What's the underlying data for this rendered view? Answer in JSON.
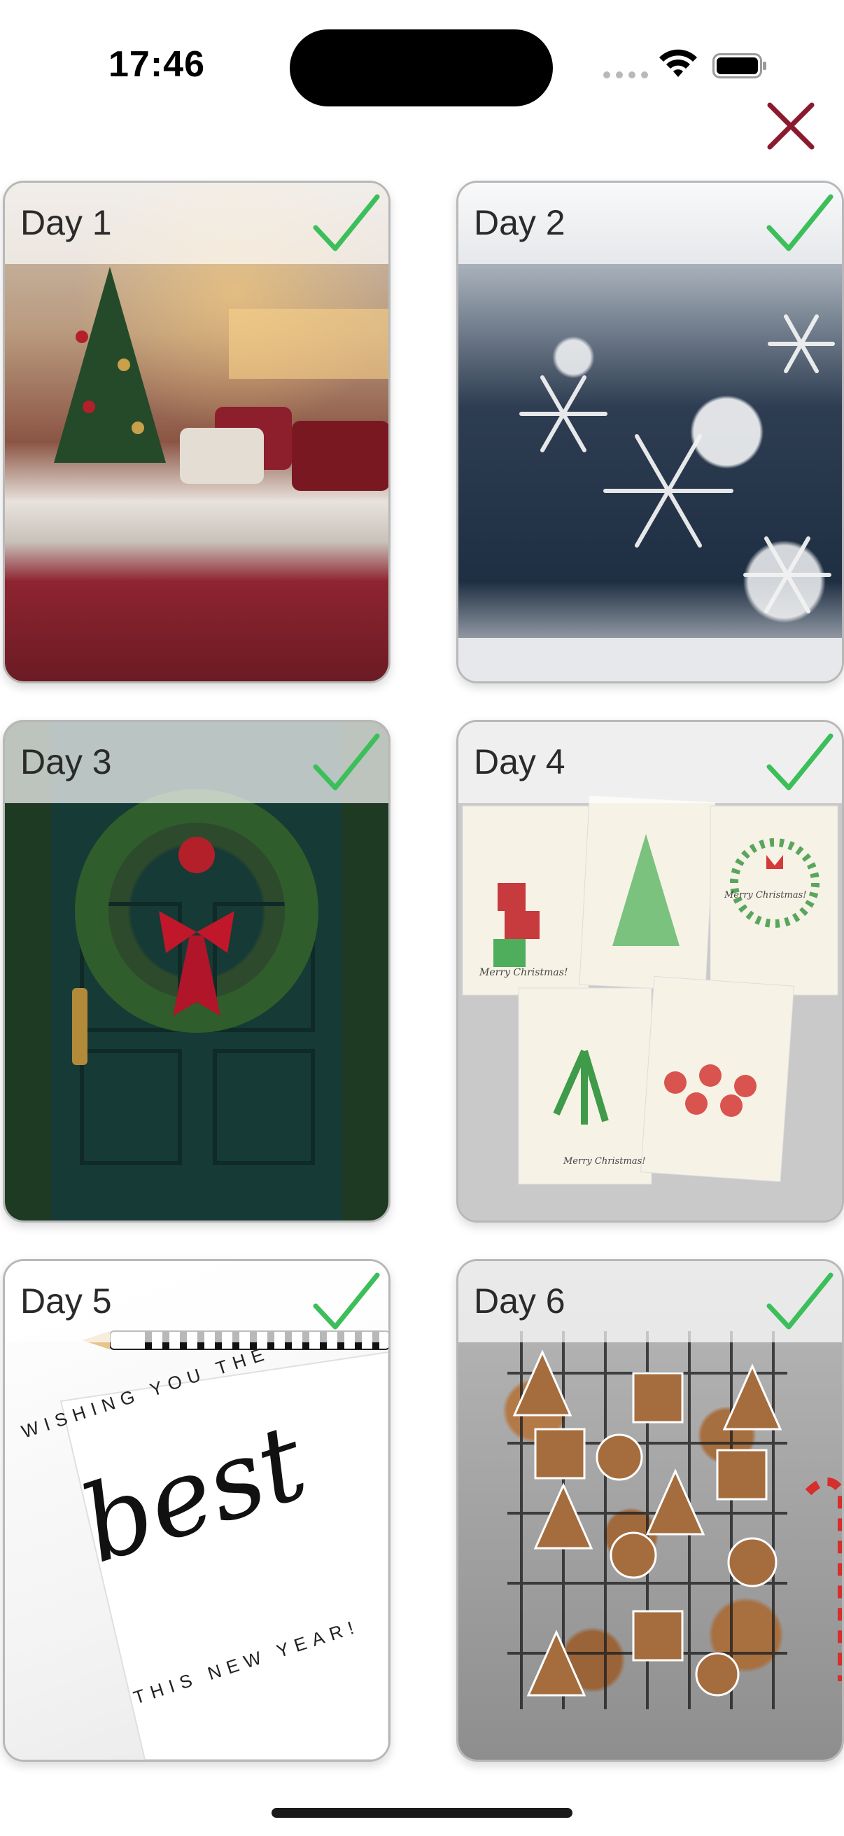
{
  "status_bar": {
    "time": "17:46"
  },
  "icons": {
    "close": "close-x-icon",
    "check": "checkmark-icon",
    "wifi": "wifi-icon",
    "battery": "battery-icon"
  },
  "colors": {
    "close": "#8b1a2e",
    "check": "#3cbf5a"
  },
  "days": [
    {
      "label": "Day 1",
      "completed": true
    },
    {
      "label": "Day 2",
      "completed": true
    },
    {
      "label": "Day 3",
      "completed": true
    },
    {
      "label": "Day 4",
      "completed": true
    },
    {
      "label": "Day 5",
      "completed": true
    },
    {
      "label": "Day 6",
      "completed": true
    }
  ],
  "day5_card": {
    "line1": "WISHING YOU THE",
    "script": "best",
    "line2": "THIS NEW YEAR!"
  },
  "day4_cards": {
    "text": "Merry Christmas!"
  }
}
